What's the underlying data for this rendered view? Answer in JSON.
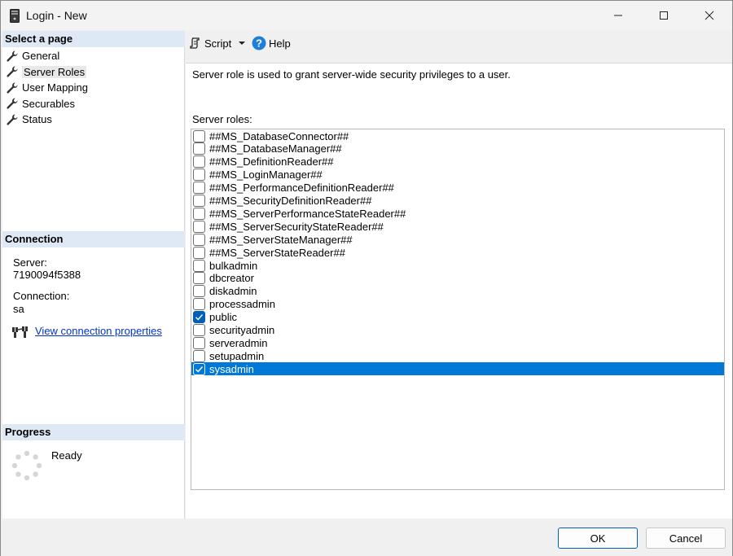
{
  "window": {
    "title": "Login - New"
  },
  "left": {
    "select_page_header": "Select a page",
    "pages": [
      {
        "label": "General",
        "selected": false
      },
      {
        "label": "Server Roles",
        "selected": true
      },
      {
        "label": "User Mapping",
        "selected": false
      },
      {
        "label": "Securables",
        "selected": false
      },
      {
        "label": "Status",
        "selected": false
      }
    ],
    "connection_header": "Connection",
    "server_label": "Server:",
    "server_value": "7190094f5388",
    "connection_label": "Connection:",
    "connection_value": "sa",
    "view_props_link": "View connection properties",
    "progress_header": "Progress",
    "progress_status": "Ready"
  },
  "toolbar": {
    "script_label": "Script",
    "help_label": "Help"
  },
  "main": {
    "description": "Server role is used to grant server-wide security privileges to a user.",
    "roles_label": "Server roles:",
    "roles": [
      {
        "name": "##MS_DatabaseConnector##",
        "checked": false,
        "selected": false
      },
      {
        "name": "##MS_DatabaseManager##",
        "checked": false,
        "selected": false
      },
      {
        "name": "##MS_DefinitionReader##",
        "checked": false,
        "selected": false
      },
      {
        "name": "##MS_LoginManager##",
        "checked": false,
        "selected": false
      },
      {
        "name": "##MS_PerformanceDefinitionReader##",
        "checked": false,
        "selected": false
      },
      {
        "name": "##MS_SecurityDefinitionReader##",
        "checked": false,
        "selected": false
      },
      {
        "name": "##MS_ServerPerformanceStateReader##",
        "checked": false,
        "selected": false
      },
      {
        "name": "##MS_ServerSecurityStateReader##",
        "checked": false,
        "selected": false
      },
      {
        "name": "##MS_ServerStateManager##",
        "checked": false,
        "selected": false
      },
      {
        "name": "##MS_ServerStateReader##",
        "checked": false,
        "selected": false
      },
      {
        "name": "bulkadmin",
        "checked": false,
        "selected": false
      },
      {
        "name": "dbcreator",
        "checked": false,
        "selected": false
      },
      {
        "name": "diskadmin",
        "checked": false,
        "selected": false
      },
      {
        "name": "processadmin",
        "checked": false,
        "selected": false
      },
      {
        "name": "public",
        "checked": true,
        "selected": false
      },
      {
        "name": "securityadmin",
        "checked": false,
        "selected": false
      },
      {
        "name": "serveradmin",
        "checked": false,
        "selected": false
      },
      {
        "name": "setupadmin",
        "checked": false,
        "selected": false
      },
      {
        "name": "sysadmin",
        "checked": true,
        "selected": true
      }
    ]
  },
  "footer": {
    "ok_label": "OK",
    "cancel_label": "Cancel"
  },
  "colors": {
    "accent": "#0078d7",
    "header_bg": "#dfe9f5",
    "link": "#0033cc"
  }
}
